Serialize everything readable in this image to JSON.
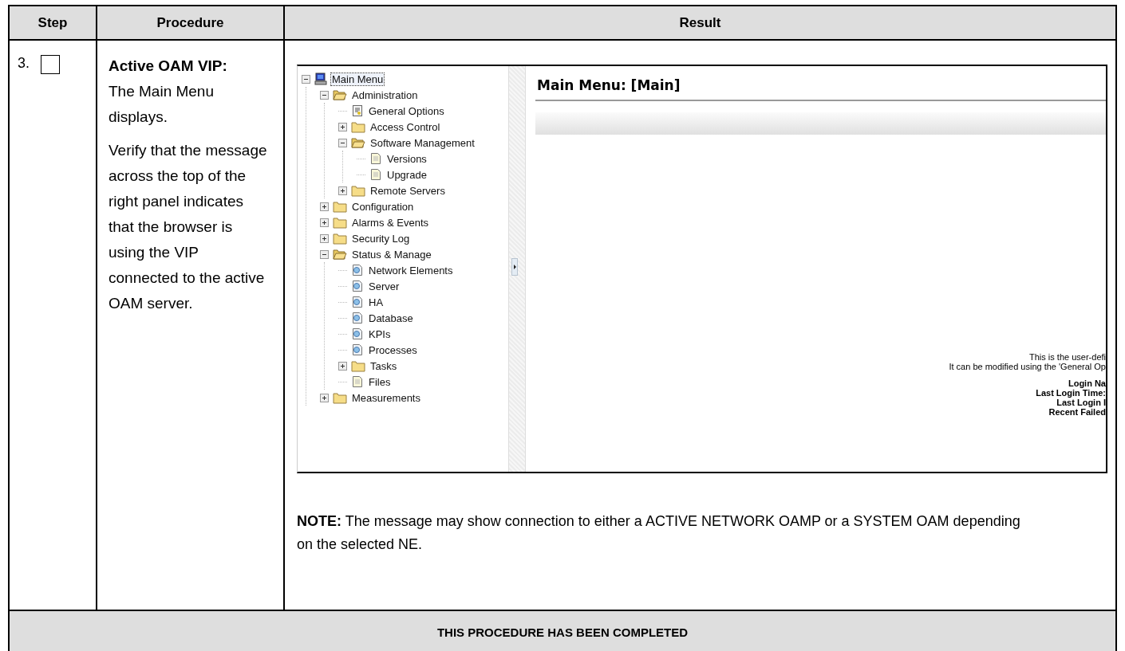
{
  "table": {
    "columns": [
      "Step",
      "Procedure",
      "Result"
    ],
    "rows": [
      {
        "step": "3.",
        "checked": false,
        "procedure_title": "Active OAM VIP:",
        "procedure_paragraphs": [
          "The Main Menu displays.",
          "Verify that the message across the top of the right panel indicates that the browser is using the VIP connected to the active OAM server."
        ],
        "screenshot": {
          "tree": [
            {
              "label": "Main Menu",
              "kind": "computer",
              "expanded": true,
              "selected": true,
              "children": [
                {
                  "label": "Administration",
                  "kind": "folder",
                  "expanded": true,
                  "selected": false,
                  "children": [
                    {
                      "label": "General Options",
                      "kind": "options",
                      "selected": false
                    },
                    {
                      "label": "Access Control",
                      "kind": "folder",
                      "expanded": false,
                      "selected": false
                    },
                    {
                      "label": "Software Management",
                      "kind": "folder",
                      "expanded": true,
                      "selected": false,
                      "children": [
                        {
                          "label": "Versions",
                          "kind": "page",
                          "selected": false
                        },
                        {
                          "label": "Upgrade",
                          "kind": "page",
                          "selected": false
                        }
                      ]
                    },
                    {
                      "label": "Remote Servers",
                      "kind": "folder",
                      "expanded": false,
                      "selected": false
                    }
                  ]
                },
                {
                  "label": "Configuration",
                  "kind": "folder",
                  "expanded": false,
                  "selected": false
                },
                {
                  "label": "Alarms & Events",
                  "kind": "folder",
                  "expanded": false,
                  "selected": false
                },
                {
                  "label": "Security Log",
                  "kind": "folder",
                  "expanded": false,
                  "selected": false
                },
                {
                  "label": "Status & Manage",
                  "kind": "folder",
                  "expanded": true,
                  "selected": false,
                  "children": [
                    {
                      "label": "Network Elements",
                      "kind": "status",
                      "selected": false
                    },
                    {
                      "label": "Server",
                      "kind": "status",
                      "selected": false
                    },
                    {
                      "label": "HA",
                      "kind": "status",
                      "selected": false
                    },
                    {
                      "label": "Database",
                      "kind": "status",
                      "selected": false
                    },
                    {
                      "label": "KPIs",
                      "kind": "status",
                      "selected": false
                    },
                    {
                      "label": "Processes",
                      "kind": "status",
                      "selected": false
                    },
                    {
                      "label": "Tasks",
                      "kind": "folder",
                      "expanded": false,
                      "selected": false
                    },
                    {
                      "label": "Files",
                      "kind": "page",
                      "selected": false
                    }
                  ]
                },
                {
                  "label": "Measurements",
                  "kind": "folder",
                  "expanded": false,
                  "selected": false
                }
              ]
            }
          ],
          "panel_title": "Main Menu: [Main]",
          "message_lines": [
            {
              "text": "This is the user-defi",
              "bold": false
            },
            {
              "text": "It can be modified using the 'General Op",
              "bold": false
            },
            {
              "text": "Login Na",
              "bold": true
            },
            {
              "text": "Last Login Time:",
              "bold": true
            },
            {
              "text": "Last Login I",
              "bold": true
            },
            {
              "text": "Recent Failed",
              "bold": true
            }
          ]
        },
        "note": "**NOTE:** The message may show connection to either a ACTIVE NETWORK OAMP or a SYSTEM OAM depending on the selected NE."
      }
    ],
    "footer": "THIS PROCEDURE HAS BEEN COMPLETED"
  }
}
